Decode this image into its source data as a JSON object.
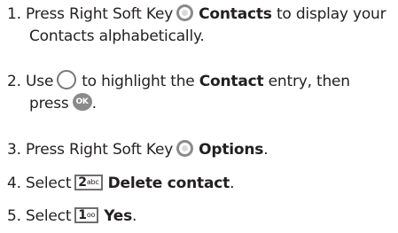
{
  "steps": [
    {
      "number": "1.",
      "pre": "Press Right Soft Key",
      "icon": "right-soft-key-icon",
      "bold": "Contacts",
      "post": "to display your",
      "line2": "Contacts alphabetically."
    },
    {
      "number": "2.",
      "pre": "Use",
      "icon": "navigation-key-icon",
      "post_a": "to highlight the",
      "bold": "Contact",
      "post_b": "entry, then",
      "line2_pre": "press",
      "ok_label": "OK",
      "line2_post": "."
    },
    {
      "number": "3.",
      "pre": "Press Right Soft Key",
      "icon": "right-soft-key-icon",
      "bold": "Options",
      "post": "."
    },
    {
      "number": "4.",
      "pre": "Select",
      "key_digit": "2",
      "key_letters": "abc",
      "bold": "Delete contact",
      "post": "."
    },
    {
      "number": "5.",
      "pre": "Select",
      "key_digit": "1",
      "key_letters": "oo",
      "bold": "Yes",
      "post": "."
    }
  ]
}
